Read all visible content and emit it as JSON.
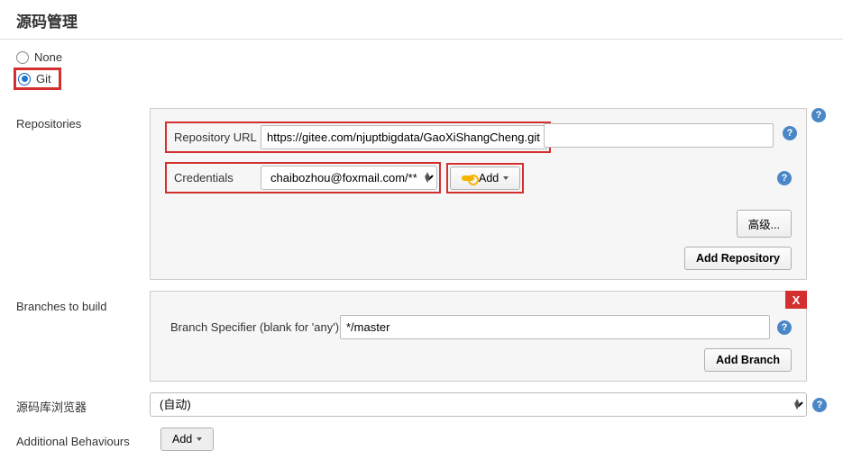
{
  "section_title": "源码管理",
  "scm": {
    "none_label": "None",
    "git_label": "Git"
  },
  "repositories": {
    "label": "Repositories",
    "url_label": "Repository URL",
    "url_value": "https://gitee.com/njuptbigdata/GaoXiShangCheng.git",
    "credentials_label": "Credentials",
    "credentials_value": "chaibozhou@foxmail.com/******",
    "add_cred_label": "Add",
    "advanced_label": "高级...",
    "add_repo_label": "Add Repository"
  },
  "branches": {
    "label": "Branches to build",
    "specifier_label": "Branch Specifier (blank for 'any')",
    "specifier_value": "*/master",
    "x_label": "X",
    "add_branch_label": "Add Branch"
  },
  "browser": {
    "label": "源码库浏览器",
    "value": "(自动)"
  },
  "additional": {
    "label": "Additional Behaviours",
    "add_label": "Add"
  },
  "help_glyph": "?"
}
